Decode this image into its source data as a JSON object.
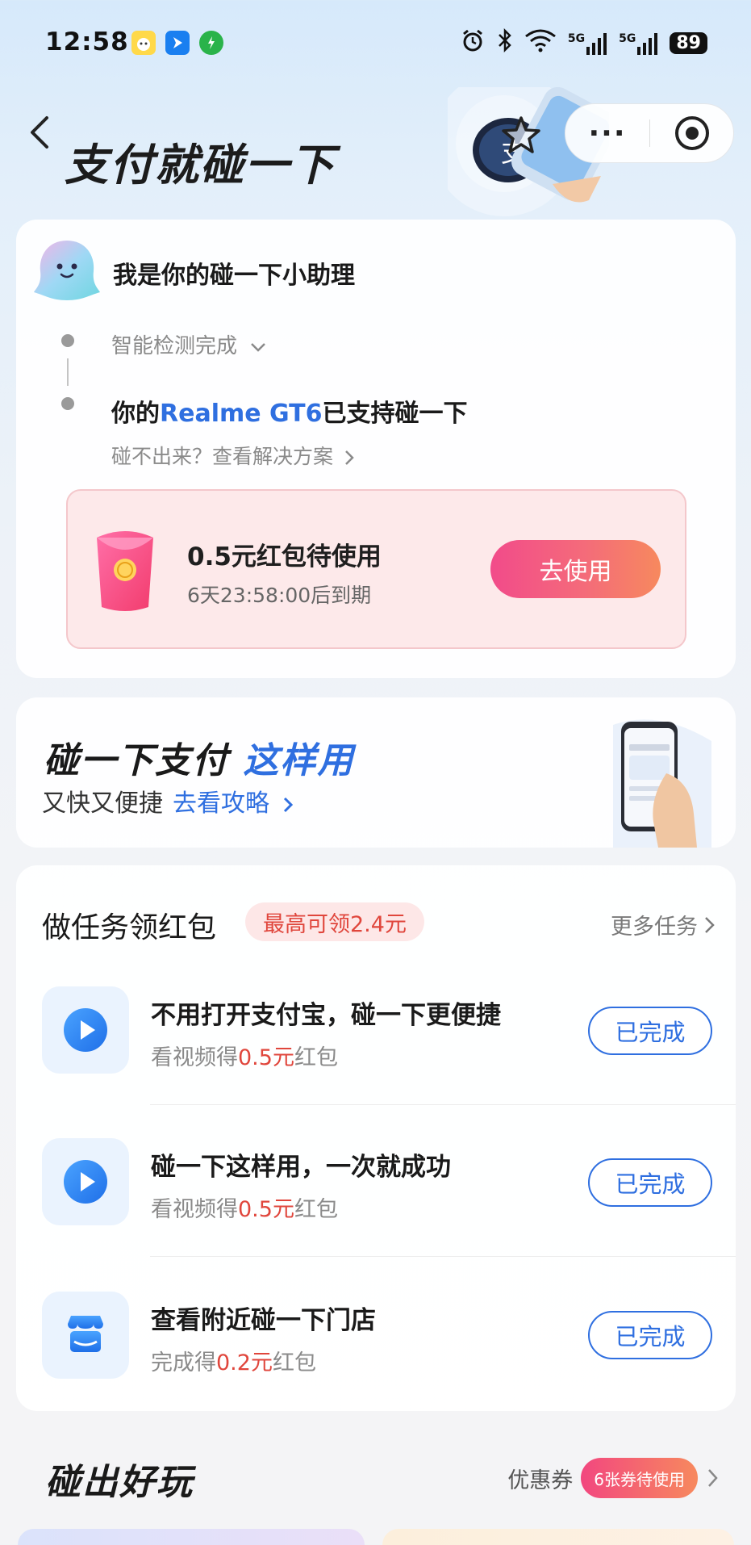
{
  "status_bar": {
    "time": "12:58",
    "battery": "89",
    "network_1": "5G",
    "network_2": "5G",
    "app_icons": [
      "nuomi-app-icon",
      "navigation-app-icon",
      "shield-app-icon"
    ]
  },
  "header": {
    "title": "支付就碰一下",
    "more_label": "···"
  },
  "assistant": {
    "title": "我是你的碰一下小助理",
    "step1": "智能检测完成",
    "step2_prefix": "你的",
    "step2_device": "Realme GT6",
    "step2_suffix": "已支持碰一下",
    "help_link": "碰不出来？查看解决方案",
    "coupon": {
      "title": "0.5元红包待使用",
      "expiry": "6天23:58:00后到期",
      "button": "去使用"
    }
  },
  "guide": {
    "title_prefix": "碰一下支付",
    "title_highlight": "这样用",
    "subtitle": "又快又便捷",
    "link": "去看攻略"
  },
  "tasks": {
    "title": "做任务领红包",
    "badge": "最高可领2.4元",
    "more": "更多任务",
    "items": [
      {
        "title": "不用打开支付宝，碰一下更便捷",
        "sub_prefix": "看视频得",
        "amount": "0.5元",
        "sub_suffix": "红包",
        "button": "已完成",
        "icon": "play-icon"
      },
      {
        "title": "碰一下这样用，一次就成功",
        "sub_prefix": "看视频得",
        "amount": "0.5元",
        "sub_suffix": "红包",
        "button": "已完成",
        "icon": "play-icon"
      },
      {
        "title": "查看附近碰一下门店",
        "sub_prefix": "完成得",
        "amount": "0.2元",
        "sub_suffix": "红包",
        "button": "已完成",
        "icon": "store-icon"
      }
    ]
  },
  "fun": {
    "title": "碰出好玩",
    "coupon_label": "优惠券",
    "coupon_badge": "6张券待使用"
  },
  "colors": {
    "accent_blue": "#2f6fe0",
    "accent_red": "#e0463c",
    "button_gradient_start": "#f24b8a",
    "button_gradient_end": "#f7895e"
  }
}
